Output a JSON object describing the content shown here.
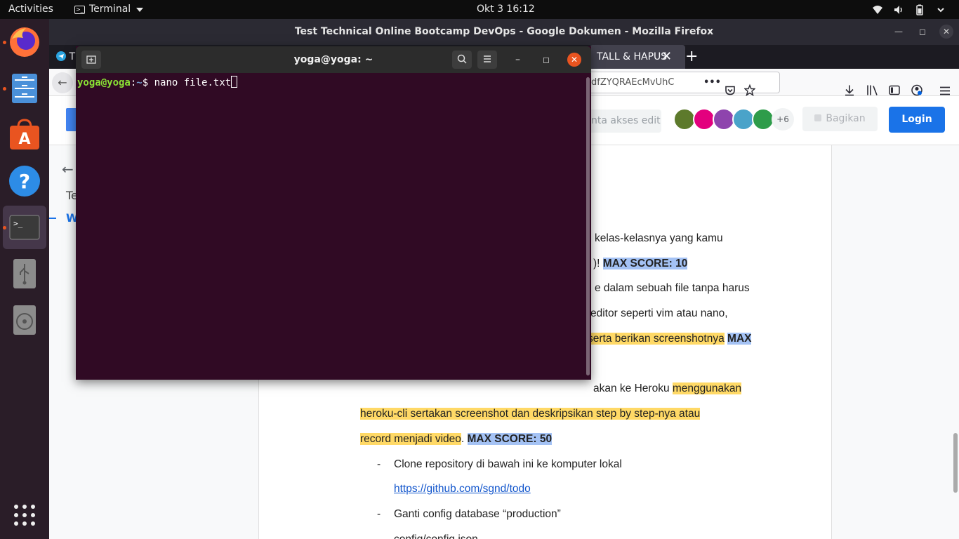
{
  "topbar": {
    "activities": "Activities",
    "app_name": "Terminal",
    "clock": "Okt 3  16:12"
  },
  "dock": {
    "items": [
      {
        "name": "Firefox"
      },
      {
        "name": "Files"
      },
      {
        "name": "Ubuntu Software"
      },
      {
        "name": "Help"
      },
      {
        "name": "Terminal"
      },
      {
        "name": "USB"
      },
      {
        "name": "Disc"
      }
    ]
  },
  "firefox": {
    "window_title": "Test Technical Online Bootcamp DevOps - Google Dokumen - Mozilla Firefox",
    "tab_first_label": "T",
    "tab_docs_label": "TALL & HAPUS",
    "tab_close": "✕",
    "new_tab": "+",
    "url": "dfZYQRAEcMvUhC",
    "more_actions": "•••"
  },
  "docs": {
    "request_edit": "nta akses edit",
    "more_collaborators": "+6",
    "share_label": "Bagikan",
    "login_label": "Login",
    "outline_title": "Te",
    "outline_item": "W",
    "lines": {
      "l1": "kelas-kelasnya yang kamu",
      "l2a": ")!",
      "l2b": "MAX SCORE: 10",
      "l3": "e dalam sebuah file tanpa harus",
      "l4": "editor   seperti   vim   atau   nano,",
      "l5a": "serta  berikan  screenshotnya",
      "l5b": "MAX",
      "l6a": "akan ke Heroku",
      "l6b": "menggunakan",
      "l7": "heroku-cli sertakan screenshot dan deskripsikan step by step-nya atau",
      "l8a": "record menjadi video",
      "l8b": ".",
      "l8c": "MAX SCORE: 50",
      "bullet1": "Clone repository di bawah ini ke komputer lokal",
      "link1": "https://github.com/sgnd/todo",
      "bullet2": "Ganti config database “production”",
      "config_path": "config/config.json",
      "dash": "-"
    }
  },
  "terminal": {
    "title": "yoga@yoga: ~",
    "prompt_user": "yoga@yoga",
    "prompt_sep": ":",
    "prompt_path": "~",
    "prompt_dollar": "$",
    "command": "nano file.txt"
  }
}
